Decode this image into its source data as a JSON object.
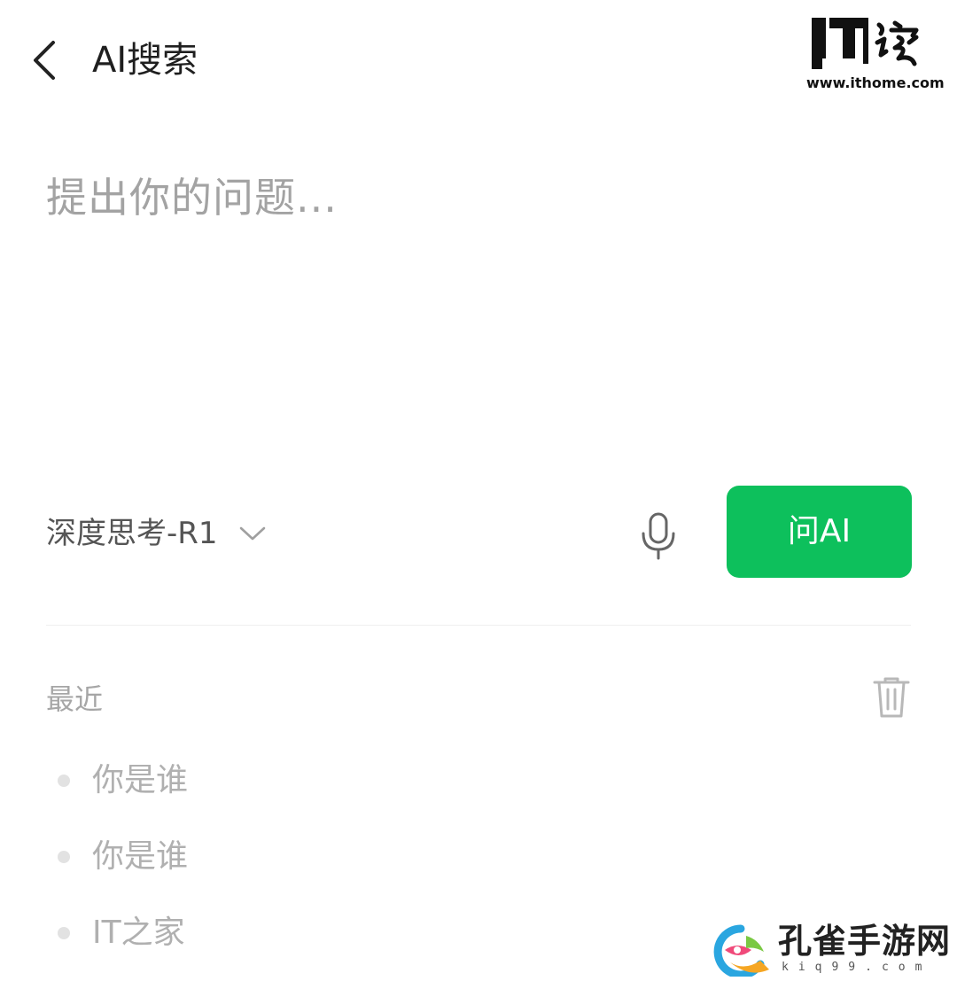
{
  "header": {
    "title": "AI搜索",
    "back_icon": "chevron-left-icon"
  },
  "brand": {
    "logo_text": "IT之家",
    "url": "www.ithome.com"
  },
  "composer": {
    "placeholder": "提出你的问题...",
    "value": "",
    "model_label": "深度思考-R1",
    "model_dropdown_icon": "chevron-down-icon",
    "mic_icon": "microphone-icon",
    "submit_label": "问AI"
  },
  "recent": {
    "label": "最近",
    "clear_icon": "trash-icon",
    "items": [
      {
        "text": "你是谁"
      },
      {
        "text": "你是谁"
      },
      {
        "text": "IT之家"
      }
    ]
  },
  "watermark": {
    "title": "孔雀手游网",
    "url": "kiq99.com"
  },
  "colors": {
    "accent": "#0dc05c",
    "text_primary": "#1f1f1f",
    "text_muted": "#a6a6a6",
    "placeholder": "#a3a3a3",
    "divider": "#f0f0f0"
  }
}
